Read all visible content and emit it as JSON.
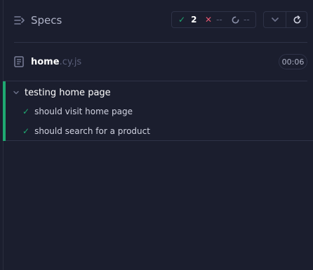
{
  "header": {
    "title": "Specs",
    "stats": {
      "passed_icon": "check-icon",
      "passed": "2",
      "failed_icon": "x-icon",
      "failed": "--",
      "pending_icon": "spinner-icon",
      "pending": "--"
    },
    "controls": {
      "collapse_icon": "chevron-down-icon",
      "rerun_icon": "refresh-icon"
    }
  },
  "spec_file": {
    "icon": "document-icon",
    "name": "home",
    "extension": ".cy.js",
    "duration": "00:06"
  },
  "suite": {
    "title": "testing home page",
    "status_color": "#1fa971",
    "tests": [
      {
        "status": "passed",
        "label": "should visit home page"
      },
      {
        "status": "passed",
        "label": "should search for a product"
      }
    ]
  },
  "colors": {
    "background": "#1b1e2e",
    "pass": "#1fa971",
    "fail": "#e45770",
    "border": "#2e3247"
  }
}
